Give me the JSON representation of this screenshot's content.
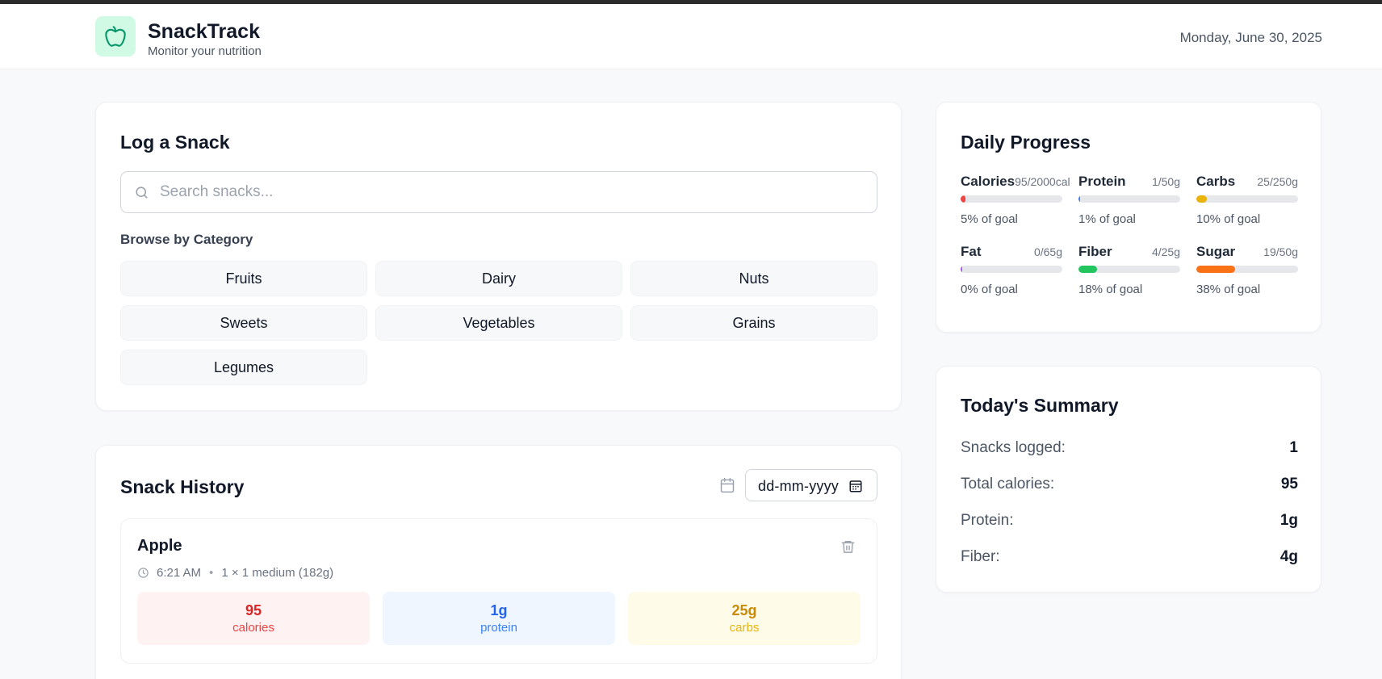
{
  "header": {
    "app_name": "SnackTrack",
    "subtitle": "Monitor your nutrition",
    "date": "Monday, June 30, 2025",
    "logo_icon": "apple-icon"
  },
  "log_snack": {
    "title": "Log a Snack",
    "search_placeholder": "Search snacks...",
    "browse_label": "Browse by Category",
    "categories": [
      "Fruits",
      "Dairy",
      "Nuts",
      "Sweets",
      "Vegetables",
      "Grains",
      "Legumes"
    ]
  },
  "history": {
    "title": "Snack History",
    "date_placeholder": "dd-mm-yyyy",
    "entries": [
      {
        "name": "Apple",
        "time": "6:21 AM",
        "portion": "1 × 1 medium (182g)",
        "calories": {
          "value": "95",
          "label": "calories"
        },
        "protein": {
          "value": "1g",
          "label": "protein"
        },
        "carbs": {
          "value": "25g",
          "label": "carbs"
        }
      }
    ]
  },
  "daily_progress": {
    "title": "Daily Progress",
    "items": [
      {
        "name": "Calories",
        "value": "95/2000cal",
        "pct_text": "5% of goal",
        "fraction": 0.05,
        "color": "#ef4444"
      },
      {
        "name": "Protein",
        "value": "1/50g",
        "pct_text": "1% of goal",
        "fraction": 0.01,
        "color": "#3b82f6"
      },
      {
        "name": "Carbs",
        "value": "25/250g",
        "pct_text": "10% of goal",
        "fraction": 0.1,
        "color": "#eab308"
      },
      {
        "name": "Fat",
        "value": "0/65g",
        "pct_text": "0% of goal",
        "fraction": 0.0,
        "color": "#a855f7"
      },
      {
        "name": "Fiber",
        "value": "4/25g",
        "pct_text": "18% of goal",
        "fraction": 0.18,
        "color": "#22c55e"
      },
      {
        "name": "Sugar",
        "value": "19/50g",
        "pct_text": "38% of goal",
        "fraction": 0.38,
        "color": "#f97316"
      }
    ]
  },
  "summary": {
    "title": "Today's Summary",
    "rows": [
      {
        "label": "Snacks logged:",
        "value": "1"
      },
      {
        "label": "Total calories:",
        "value": "95"
      },
      {
        "label": "Protein:",
        "value": "1g"
      },
      {
        "label": "Fiber:",
        "value": "4g"
      }
    ]
  },
  "colors": {
    "accent": "#10b981",
    "calories_bg": "#fef2f2",
    "calories_text": "#dc2626",
    "protein_bg": "#eff6ff",
    "protein_text": "#2563eb",
    "carbs_bg": "#fefce8",
    "carbs_text": "#ca8a04"
  }
}
